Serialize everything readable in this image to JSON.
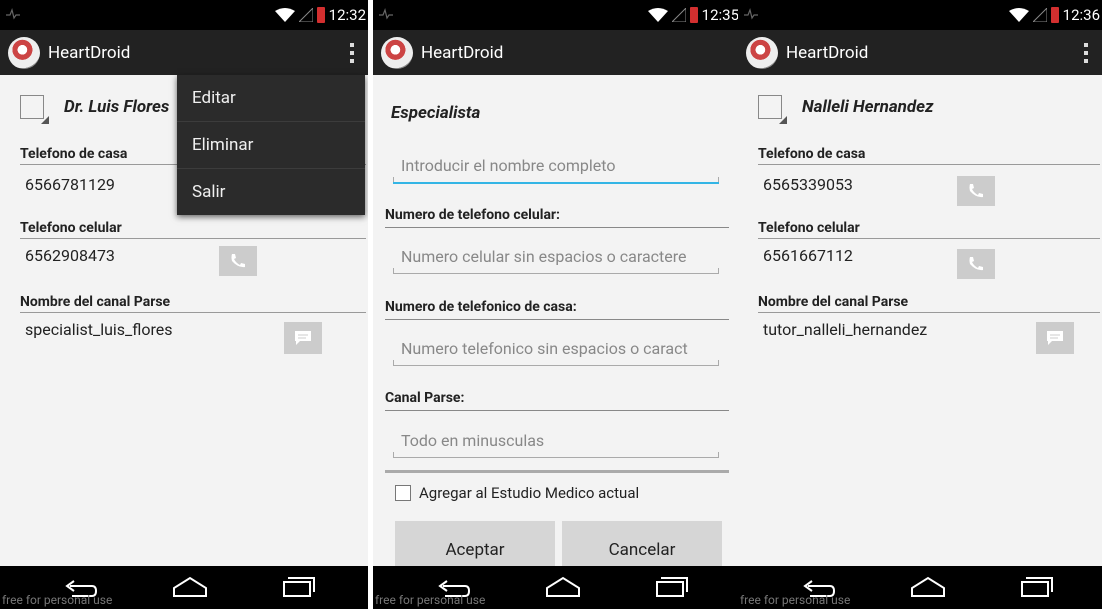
{
  "app": {
    "title": "HeartDroid",
    "watermark": "free for personal use"
  },
  "screens": [
    {
      "time": "12:32",
      "name": "Dr. Luis Flores",
      "home_label": "Telefono de casa",
      "home_value": "6566781129",
      "cell_label": "Telefono celular",
      "cell_value": "6562908473",
      "channel_label": "Nombre del canal Parse",
      "channel_value": "specialist_luis_flores",
      "menu": [
        "Editar",
        "Eliminar",
        "Salir"
      ]
    },
    {
      "time": "12:35",
      "title": "Especialista",
      "name_placeholder": "Introducir el nombre completo",
      "cell_label": "Numero de telefono celular:",
      "cell_placeholder": "Numero celular sin espacios o caractere",
      "home_label": "Numero de telefonico de casa:",
      "home_placeholder": "Numero telefonico sin espacios o caract",
      "channel_label": "Canal Parse:",
      "channel_placeholder": "Todo en minusculas",
      "checkbox_label": "Agregar al Estudio Medico actual",
      "accept_label": "Aceptar",
      "cancel_label": "Cancelar"
    },
    {
      "time": "12:36",
      "name": "Nalleli Hernandez",
      "home_label": "Telefono de casa",
      "home_value": "6565339053",
      "cell_label": "Telefono celular",
      "cell_value": "6561667112",
      "channel_label": "Nombre del canal Parse",
      "channel_value": "tutor_nalleli_hernandez"
    }
  ],
  "colors": {
    "accent": "#33b5e5",
    "actionbar": "#222222",
    "battery": "#d32f2f"
  }
}
